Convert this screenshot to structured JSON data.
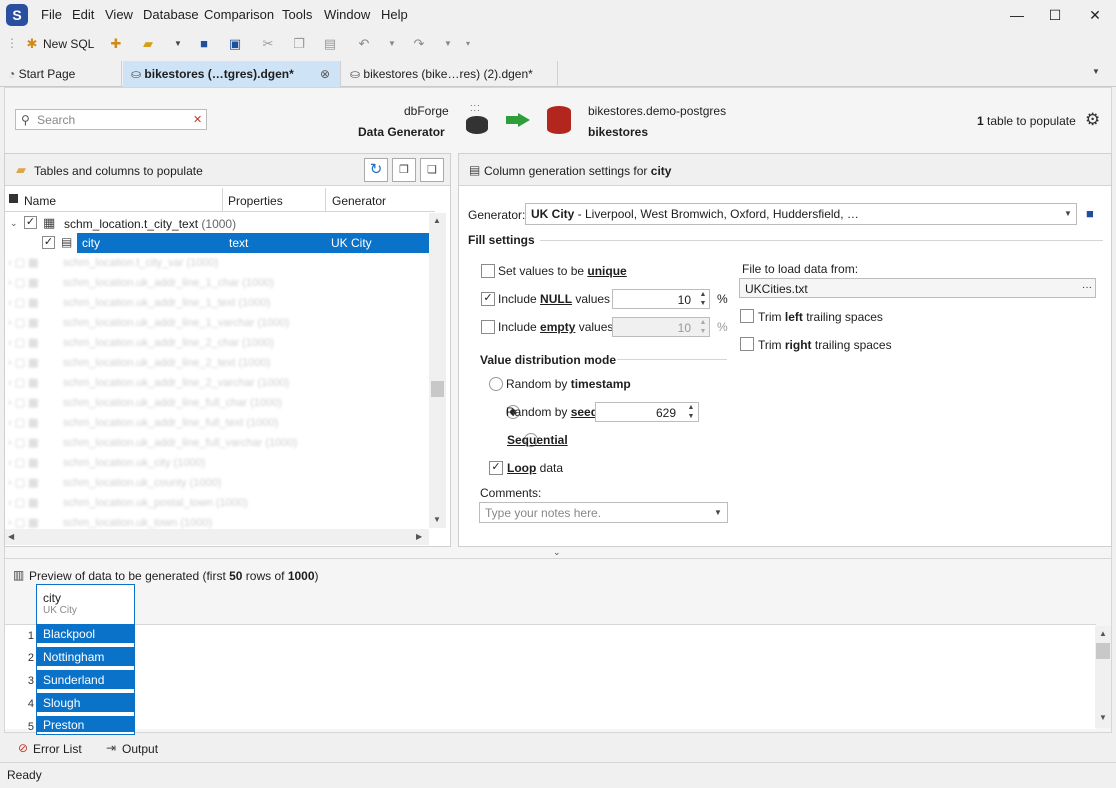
{
  "app": {
    "logo_letter": "S"
  },
  "menu": [
    "File",
    "Edit",
    "View",
    "Database",
    "Comparison",
    "Tools",
    "Window",
    "Help"
  ],
  "window_controls": {
    "minimize": "—",
    "maximize": "☐",
    "close": "✕"
  },
  "toolbar": {
    "new_sql": "New SQL"
  },
  "tabs": [
    {
      "label": "Start Page",
      "active": false
    },
    {
      "label": "bikestores (…tgres).dgen*",
      "active": true
    },
    {
      "label": "bikestores (bike…res) (2).dgen*",
      "active": false
    }
  ],
  "header": {
    "search_placeholder": "Search",
    "source_line1": "dbForge",
    "source_line2": "Data Generator",
    "target_line1": "bikestores.demo-postgres",
    "target_line2": "bikestores",
    "count": "1",
    "count_suffix": " table to populate"
  },
  "left_panel": {
    "title": "Tables and columns to populate",
    "columns": [
      "Name",
      "Properties",
      "Generator"
    ],
    "table_row": {
      "name": "schm_location.t_city_text",
      "count": "(1000)"
    },
    "selected_row": {
      "name": "city",
      "property": "text",
      "generator": "UK City"
    },
    "blurred_rows": [
      "schm_location.t_city_var (1000)",
      "schm_location.uk_addr_line_1_char (1000)",
      "schm_location.uk_addr_line_1_text (1000)",
      "schm_location.uk_addr_line_1_varchar (1000)",
      "schm_location.uk_addr_line_2_char (1000)",
      "schm_location.uk_addr_line_2_text (1000)",
      "schm_location.uk_addr_line_2_varchar (1000)",
      "schm_location.uk_addr_line_full_char (1000)",
      "schm_location.uk_addr_line_full_text (1000)",
      "schm_location.uk_addr_line_full_varchar (1000)",
      "schm_location.uk_city (1000)",
      "schm_location.uk_county (1000)",
      "schm_location.uk_postal_town (1000)",
      "schm_location.uk_town (1000)"
    ]
  },
  "right_panel": {
    "title_prefix": "Column generation settings for ",
    "title_column": "city",
    "generator_label": "Generator:",
    "generator_name": "UK City",
    "generator_desc": " - Liverpool, West Bromwich, Oxford, Huddersfield, …",
    "fill_settings": "Fill settings",
    "unique_label_a": "Set values to be ",
    "unique_label_b": "unique",
    "null_label_a": "Include ",
    "null_label_b": "NULL",
    "null_label_c": " values",
    "null_value": "10",
    "empty_label_a": "Include ",
    "empty_label_b": "empty",
    "empty_label_c": " values",
    "empty_value": "10",
    "percent": "%",
    "dist_title": "Value distribution mode",
    "rand_ts_a": "Random by ",
    "rand_ts_b": "timestamp",
    "rand_seed_a": "Random by ",
    "rand_seed_b": "seed",
    "seed_value": "629",
    "sequential": "Sequential",
    "loop_a": "Loop",
    "loop_b": " data",
    "comments_label": "Comments:",
    "comments_placeholder": "Type your notes here.",
    "file_label": "File to load data from:",
    "file_value": "UKCities.txt",
    "file_btn": "···",
    "trim_left_a": "Trim ",
    "trim_left_b": "left",
    "trim_left_c": " trailing spaces",
    "trim_right_a": "Trim ",
    "trim_right_b": "right",
    "trim_right_c": " trailing spaces"
  },
  "preview": {
    "title_a": "Preview of data to be generated (first ",
    "rows": "50",
    "title_b": " rows of ",
    "total": "1000",
    "title_c": ")",
    "column_name": "city",
    "column_gen": "UK City",
    "values": [
      "Blackpool",
      "Nottingham",
      "Sunderland",
      "Slough",
      "Preston"
    ],
    "row_numbers": [
      "1",
      "2",
      "3",
      "4",
      "5"
    ]
  },
  "bottom_tabs": {
    "errors": "Error List",
    "output": "Output"
  },
  "status": "Ready"
}
